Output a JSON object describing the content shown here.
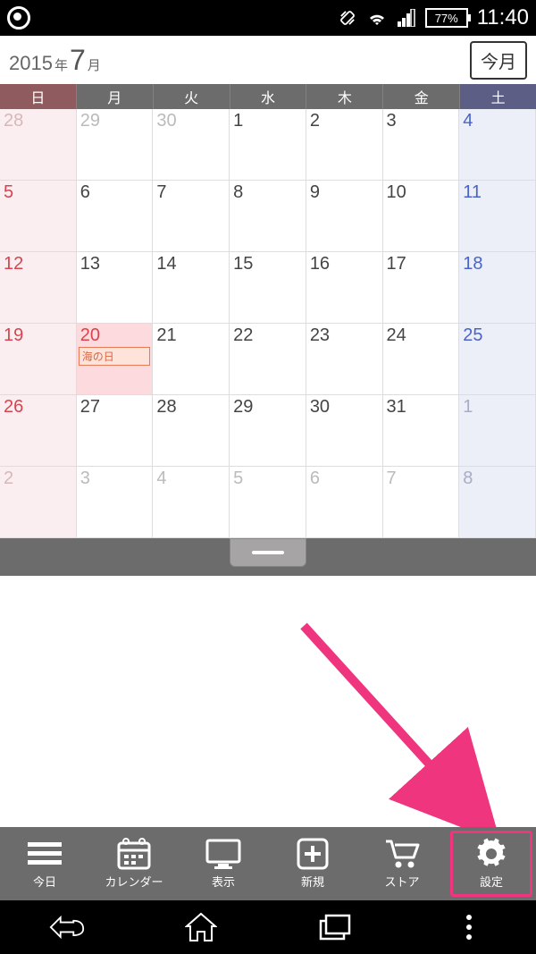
{
  "status": {
    "battery": "77%",
    "time": "11:40"
  },
  "header": {
    "year": "2015",
    "year_suffix": "年",
    "month": "7",
    "month_suffix": "月",
    "today_button": "今月"
  },
  "day_names": [
    "日",
    "月",
    "火",
    "水",
    "木",
    "金",
    "土"
  ],
  "weeks": [
    [
      {
        "d": "28",
        "dim": true,
        "t": "sun"
      },
      {
        "d": "29",
        "dim": true
      },
      {
        "d": "30",
        "dim": true
      },
      {
        "d": "1"
      },
      {
        "d": "2"
      },
      {
        "d": "3"
      },
      {
        "d": "4",
        "t": "sat",
        "c": "blue"
      }
    ],
    [
      {
        "d": "5",
        "t": "sun",
        "c": "red"
      },
      {
        "d": "6"
      },
      {
        "d": "7"
      },
      {
        "d": "8"
      },
      {
        "d": "9"
      },
      {
        "d": "10"
      },
      {
        "d": "11",
        "t": "sat",
        "c": "blue"
      }
    ],
    [
      {
        "d": "12",
        "t": "sun",
        "c": "red"
      },
      {
        "d": "13"
      },
      {
        "d": "14"
      },
      {
        "d": "15"
      },
      {
        "d": "16"
      },
      {
        "d": "17"
      },
      {
        "d": "18",
        "t": "sat",
        "c": "blue"
      }
    ],
    [
      {
        "d": "19",
        "t": "sun",
        "c": "red"
      },
      {
        "d": "20",
        "t": "hol",
        "c": "red",
        "event": "海の日"
      },
      {
        "d": "21"
      },
      {
        "d": "22"
      },
      {
        "d": "23"
      },
      {
        "d": "24"
      },
      {
        "d": "25",
        "t": "sat",
        "c": "blue"
      }
    ],
    [
      {
        "d": "26",
        "t": "sun",
        "c": "red"
      },
      {
        "d": "27"
      },
      {
        "d": "28"
      },
      {
        "d": "29"
      },
      {
        "d": "30"
      },
      {
        "d": "31"
      },
      {
        "d": "1",
        "dim": true,
        "t": "sat"
      }
    ],
    [
      {
        "d": "2",
        "dim": true,
        "t": "sun"
      },
      {
        "d": "3",
        "dim": true
      },
      {
        "d": "4",
        "dim": true
      },
      {
        "d": "5",
        "dim": true
      },
      {
        "d": "6",
        "dim": true
      },
      {
        "d": "7",
        "dim": true
      },
      {
        "d": "8",
        "dim": true,
        "t": "sat"
      }
    ]
  ],
  "toolbar": [
    {
      "id": "today",
      "label": "今日",
      "icon": "menu"
    },
    {
      "id": "calendar",
      "label": "カレンダー",
      "icon": "calendar"
    },
    {
      "id": "view",
      "label": "表示",
      "icon": "monitor"
    },
    {
      "id": "new",
      "label": "新規",
      "icon": "plus"
    },
    {
      "id": "store",
      "label": "ストア",
      "icon": "cart"
    },
    {
      "id": "settings",
      "label": "設定",
      "icon": "gear",
      "highlighted": true
    }
  ]
}
